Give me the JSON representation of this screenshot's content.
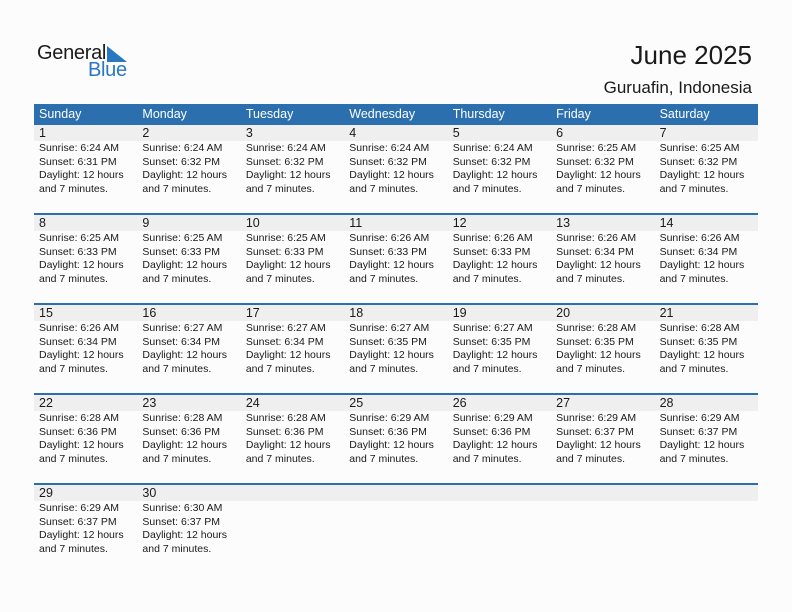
{
  "logo": {
    "word1": "General",
    "word2": "Blue"
  },
  "header": {
    "title": "June 2025",
    "location": "Guruafin, Indonesia"
  },
  "colors": {
    "accent": "#2b6faf",
    "logo_blue": "#2a78c2",
    "date_strip": "#efefef"
  },
  "weekdays": [
    "Sunday",
    "Monday",
    "Tuesday",
    "Wednesday",
    "Thursday",
    "Friday",
    "Saturday"
  ],
  "weeks": [
    [
      {
        "day": "1",
        "sunrise": "Sunrise: 6:24 AM",
        "sunset": "Sunset: 6:31 PM",
        "daylight1": "Daylight: 12 hours",
        "daylight2": "and 7 minutes."
      },
      {
        "day": "2",
        "sunrise": "Sunrise: 6:24 AM",
        "sunset": "Sunset: 6:32 PM",
        "daylight1": "Daylight: 12 hours",
        "daylight2": "and 7 minutes."
      },
      {
        "day": "3",
        "sunrise": "Sunrise: 6:24 AM",
        "sunset": "Sunset: 6:32 PM",
        "daylight1": "Daylight: 12 hours",
        "daylight2": "and 7 minutes."
      },
      {
        "day": "4",
        "sunrise": "Sunrise: 6:24 AM",
        "sunset": "Sunset: 6:32 PM",
        "daylight1": "Daylight: 12 hours",
        "daylight2": "and 7 minutes."
      },
      {
        "day": "5",
        "sunrise": "Sunrise: 6:24 AM",
        "sunset": "Sunset: 6:32 PM",
        "daylight1": "Daylight: 12 hours",
        "daylight2": "and 7 minutes."
      },
      {
        "day": "6",
        "sunrise": "Sunrise: 6:25 AM",
        "sunset": "Sunset: 6:32 PM",
        "daylight1": "Daylight: 12 hours",
        "daylight2": "and 7 minutes."
      },
      {
        "day": "7",
        "sunrise": "Sunrise: 6:25 AM",
        "sunset": "Sunset: 6:32 PM",
        "daylight1": "Daylight: 12 hours",
        "daylight2": "and 7 minutes."
      }
    ],
    [
      {
        "day": "8",
        "sunrise": "Sunrise: 6:25 AM",
        "sunset": "Sunset: 6:33 PM",
        "daylight1": "Daylight: 12 hours",
        "daylight2": "and 7 minutes."
      },
      {
        "day": "9",
        "sunrise": "Sunrise: 6:25 AM",
        "sunset": "Sunset: 6:33 PM",
        "daylight1": "Daylight: 12 hours",
        "daylight2": "and 7 minutes."
      },
      {
        "day": "10",
        "sunrise": "Sunrise: 6:25 AM",
        "sunset": "Sunset: 6:33 PM",
        "daylight1": "Daylight: 12 hours",
        "daylight2": "and 7 minutes."
      },
      {
        "day": "11",
        "sunrise": "Sunrise: 6:26 AM",
        "sunset": "Sunset: 6:33 PM",
        "daylight1": "Daylight: 12 hours",
        "daylight2": "and 7 minutes."
      },
      {
        "day": "12",
        "sunrise": "Sunrise: 6:26 AM",
        "sunset": "Sunset: 6:33 PM",
        "daylight1": "Daylight: 12 hours",
        "daylight2": "and 7 minutes."
      },
      {
        "day": "13",
        "sunrise": "Sunrise: 6:26 AM",
        "sunset": "Sunset: 6:34 PM",
        "daylight1": "Daylight: 12 hours",
        "daylight2": "and 7 minutes."
      },
      {
        "day": "14",
        "sunrise": "Sunrise: 6:26 AM",
        "sunset": "Sunset: 6:34 PM",
        "daylight1": "Daylight: 12 hours",
        "daylight2": "and 7 minutes."
      }
    ],
    [
      {
        "day": "15",
        "sunrise": "Sunrise: 6:26 AM",
        "sunset": "Sunset: 6:34 PM",
        "daylight1": "Daylight: 12 hours",
        "daylight2": "and 7 minutes."
      },
      {
        "day": "16",
        "sunrise": "Sunrise: 6:27 AM",
        "sunset": "Sunset: 6:34 PM",
        "daylight1": "Daylight: 12 hours",
        "daylight2": "and 7 minutes."
      },
      {
        "day": "17",
        "sunrise": "Sunrise: 6:27 AM",
        "sunset": "Sunset: 6:34 PM",
        "daylight1": "Daylight: 12 hours",
        "daylight2": "and 7 minutes."
      },
      {
        "day": "18",
        "sunrise": "Sunrise: 6:27 AM",
        "sunset": "Sunset: 6:35 PM",
        "daylight1": "Daylight: 12 hours",
        "daylight2": "and 7 minutes."
      },
      {
        "day": "19",
        "sunrise": "Sunrise: 6:27 AM",
        "sunset": "Sunset: 6:35 PM",
        "daylight1": "Daylight: 12 hours",
        "daylight2": "and 7 minutes."
      },
      {
        "day": "20",
        "sunrise": "Sunrise: 6:28 AM",
        "sunset": "Sunset: 6:35 PM",
        "daylight1": "Daylight: 12 hours",
        "daylight2": "and 7 minutes."
      },
      {
        "day": "21",
        "sunrise": "Sunrise: 6:28 AM",
        "sunset": "Sunset: 6:35 PM",
        "daylight1": "Daylight: 12 hours",
        "daylight2": "and 7 minutes."
      }
    ],
    [
      {
        "day": "22",
        "sunrise": "Sunrise: 6:28 AM",
        "sunset": "Sunset: 6:36 PM",
        "daylight1": "Daylight: 12 hours",
        "daylight2": "and 7 minutes."
      },
      {
        "day": "23",
        "sunrise": "Sunrise: 6:28 AM",
        "sunset": "Sunset: 6:36 PM",
        "daylight1": "Daylight: 12 hours",
        "daylight2": "and 7 minutes."
      },
      {
        "day": "24",
        "sunrise": "Sunrise: 6:28 AM",
        "sunset": "Sunset: 6:36 PM",
        "daylight1": "Daylight: 12 hours",
        "daylight2": "and 7 minutes."
      },
      {
        "day": "25",
        "sunrise": "Sunrise: 6:29 AM",
        "sunset": "Sunset: 6:36 PM",
        "daylight1": "Daylight: 12 hours",
        "daylight2": "and 7 minutes."
      },
      {
        "day": "26",
        "sunrise": "Sunrise: 6:29 AM",
        "sunset": "Sunset: 6:36 PM",
        "daylight1": "Daylight: 12 hours",
        "daylight2": "and 7 minutes."
      },
      {
        "day": "27",
        "sunrise": "Sunrise: 6:29 AM",
        "sunset": "Sunset: 6:37 PM",
        "daylight1": "Daylight: 12 hours",
        "daylight2": "and 7 minutes."
      },
      {
        "day": "28",
        "sunrise": "Sunrise: 6:29 AM",
        "sunset": "Sunset: 6:37 PM",
        "daylight1": "Daylight: 12 hours",
        "daylight2": "and 7 minutes."
      }
    ],
    [
      {
        "day": "29",
        "sunrise": "Sunrise: 6:29 AM",
        "sunset": "Sunset: 6:37 PM",
        "daylight1": "Daylight: 12 hours",
        "daylight2": "and 7 minutes."
      },
      {
        "day": "30",
        "sunrise": "Sunrise: 6:30 AM",
        "sunset": "Sunset: 6:37 PM",
        "daylight1": "Daylight: 12 hours",
        "daylight2": "and 7 minutes."
      },
      null,
      null,
      null,
      null,
      null
    ]
  ]
}
